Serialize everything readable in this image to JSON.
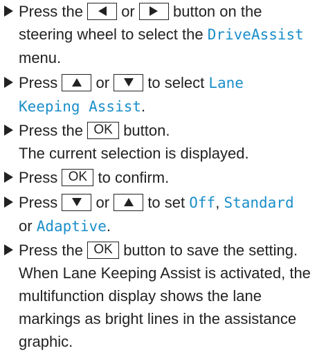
{
  "steps": [
    {
      "a": "Press the",
      "key_left_icon": "triangle-left-icon",
      "or": "or",
      "key_right_icon": "triangle-right-icon",
      "b": "button on the",
      "c": "steering wheel to select the",
      "menu": "DriveAssist",
      "d": "menu."
    },
    {
      "a": "Press",
      "key_up_icon": "triangle-up-icon",
      "or": "or",
      "key_down_icon": "triangle-down-icon",
      "b": "to select",
      "menu_line1": "Lane",
      "menu_line2": "Keeping Assist",
      "end": "."
    },
    {
      "a": "Press the",
      "key": "OK",
      "b": "button.",
      "line2": "The current selection is displayed."
    },
    {
      "a": "Press",
      "key": "OK",
      "b": "to confirm."
    },
    {
      "a": "Press",
      "key_down_icon": "triangle-down-icon",
      "or": "or",
      "key_up_icon": "triangle-up-icon",
      "b": "to set",
      "opt1": "Off",
      "comma1": ",",
      "opt2": "Standard",
      "or2": "or",
      "opt3": "Adaptive",
      "end": "."
    },
    {
      "a": "Press the",
      "key": "OK",
      "b": "button to save the setting.",
      "line2": "When Lane Keeping Assist is activated, the",
      "line3": "multifunction display shows the lane",
      "line4": "markings as bright lines in the assistance",
      "line5": "graphic."
    }
  ],
  "colors": {
    "text": "#222222",
    "menu": "#1a8ec9"
  }
}
